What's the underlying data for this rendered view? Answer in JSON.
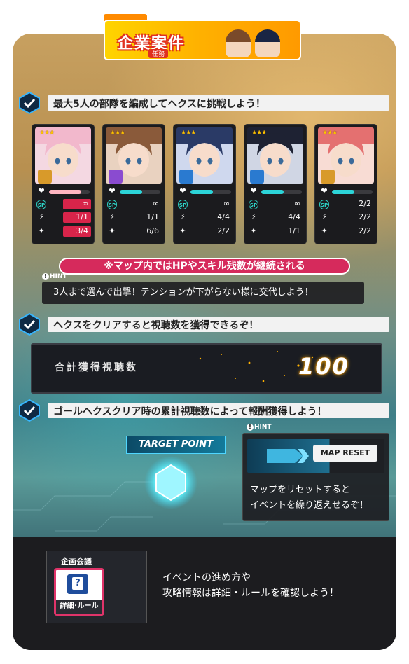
{
  "banner": {
    "title": "企業案件",
    "subtitle": "任務"
  },
  "section1": {
    "text": "最大5人の部隊を編成してヘクスに挑戦しよう！"
  },
  "units": [
    {
      "stars": "★★★",
      "hp": 0.8,
      "hp_color": "#ffb6c1",
      "sp": "∞",
      "skill1": "1/1",
      "skill2": "3/4",
      "skill1_red": true,
      "skill2_red": true,
      "sp_red": true,
      "hair": "#f2b8cc",
      "bg": "#f4d8e2",
      "role_color": "#d89a2a"
    },
    {
      "stars": "★★★",
      "hp": 0.55,
      "hp_color": "#2cd4d8",
      "sp": "∞",
      "skill1": "1/1",
      "skill2": "6/6",
      "hair": "#8a5a3a",
      "bg": "#e9d2c0",
      "role_color": "#8a4bd0"
    },
    {
      "stars": "★★★",
      "hp": 0.55,
      "hp_color": "#2cd4d8",
      "sp": "∞",
      "skill1": "4/4",
      "skill2": "2/2",
      "hair": "#2a3a66",
      "bg": "#cfd8ee",
      "role_color": "#2a7ad0"
    },
    {
      "stars": "★★★",
      "hp": 0.55,
      "hp_color": "#2cd4d8",
      "sp": "∞",
      "skill1": "4/4",
      "skill2": "1/1",
      "hair": "#1e2233",
      "bg": "#d0d6e4",
      "role_color": "#2a7ad0"
    },
    {
      "stars": "★★★",
      "hp": 0.55,
      "hp_color": "#2cd4d8",
      "sp": "2/2",
      "skill1": "2/2",
      "skill2": "2/2",
      "hair": "#e47070",
      "bg": "#f8dcd4",
      "role_color": "#d89a2a"
    }
  ],
  "notice": "※マップ内ではHPやスキル残数が継続される",
  "hint_label": "HINT",
  "hint1": "3人まで選んで出撃！テンションが下がらない様に交代しよう！",
  "section2": {
    "text": "ヘクスをクリアすると視聴数を獲得できるぞ！"
  },
  "views": {
    "label": "合計獲得視聴数",
    "value": "100"
  },
  "section3": {
    "text": "ゴールヘクスクリア時の累計視聴数によって報酬獲得しよう！"
  },
  "target": {
    "label": "TARGET POINT"
  },
  "map_hint": {
    "button": "MAP RESET",
    "text_line1": "マップをリセットすると",
    "text_line2": "イベントを繰り返えせるぞ！"
  },
  "menu": {
    "title": "企画会議",
    "button_label": "詳細･ルール",
    "icon_glyph": "?"
  },
  "bottom_text": {
    "line1": "イベントの進め方や",
    "line2": "攻略情報は詳細・ルールを確認しよう！"
  },
  "icons": {
    "sp_label": "SP",
    "hp_icon": "❤",
    "skill1_icon": "⚡",
    "skill2_icon": "✦"
  }
}
